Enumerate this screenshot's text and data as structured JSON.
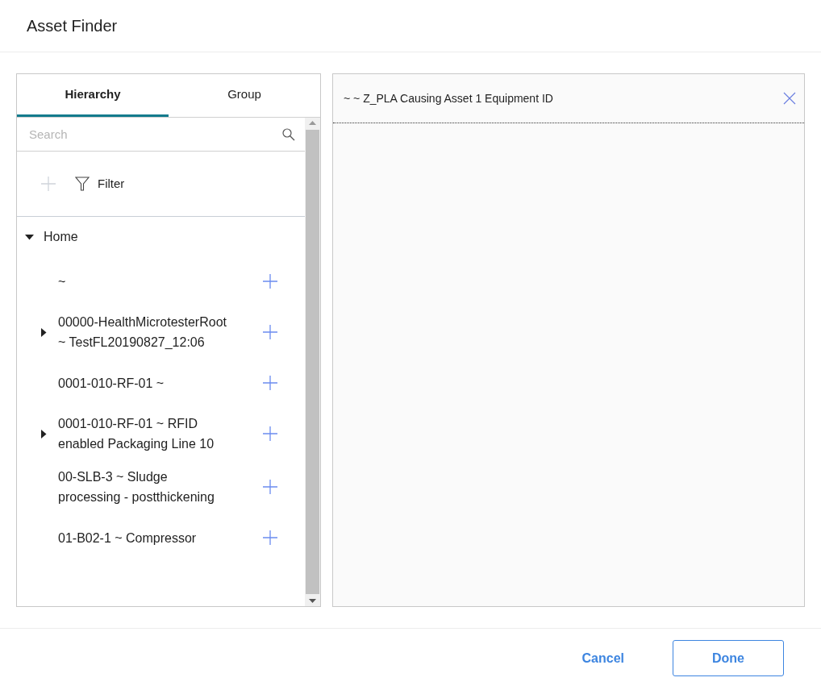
{
  "window": {
    "title": "Asset Finder"
  },
  "tabs": [
    {
      "label": "Hierarchy",
      "selected": true
    },
    {
      "label": "Group",
      "selected": false
    }
  ],
  "search": {
    "placeholder": "Search"
  },
  "toolbar": {
    "filter_label": "Filter"
  },
  "tree": {
    "label": "Home",
    "expanded": true,
    "children": [
      {
        "label": "~",
        "kind": "leaf"
      },
      {
        "label": "00000-HealthMicrotesterRoot ~ TestFL20190827_12:06",
        "kind": "branch"
      },
      {
        "label": "0001-010-RF-01 ~",
        "kind": "leaf"
      },
      {
        "label": "0001-010-RF-01 ~ RFID enabled Packaging Line 10",
        "kind": "branch"
      },
      {
        "label": "00-SLB-3 ~ Sludge processing - postthickening",
        "kind": "leaf"
      },
      {
        "label": "01-B02-1 ~ Compressor",
        "kind": "leaf"
      }
    ]
  },
  "selection": {
    "title": "~ ~ Z_PLA Causing Asset 1 Equipment ID"
  },
  "buttons": [
    {
      "label": "Cancel",
      "kind": "text"
    },
    {
      "label": "Done",
      "kind": "outline"
    }
  ]
}
